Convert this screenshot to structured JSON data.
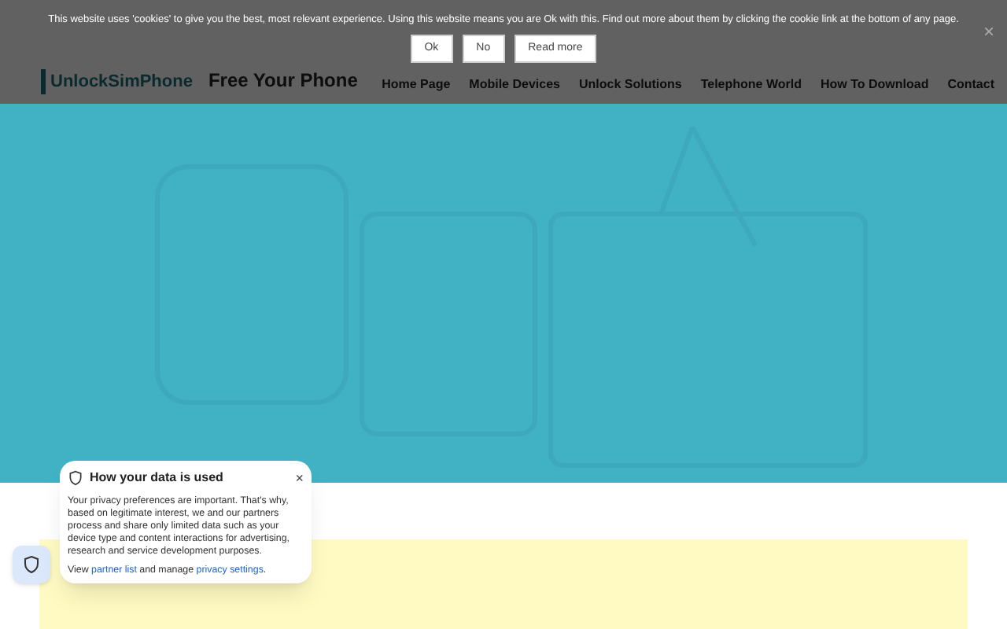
{
  "cookie_bar": {
    "message": "This website uses 'cookies' to give you the best, most relevant experience. Using this website means you are Ok with this. Find out more about them by clicking the cookie link at the bottom of any page.",
    "buttons": [
      "Ok",
      "No",
      "Read more"
    ],
    "close": "×"
  },
  "header": {
    "logo": "UnlockSimPhone",
    "tagline": "Free Your Phone",
    "nav": [
      "Home Page",
      "Mobile Devices",
      "Unlock Solutions",
      "Telephone World",
      "How To Download",
      "Contact"
    ]
  },
  "privacy_popup": {
    "title": "How your data is used",
    "close": "×",
    "body": "Your privacy preferences are important. That's why, based on legitimate interest, we and our partners process and share only limited data such as your device type and content interactions for advertising, research and service development purposes.",
    "footer_start": "View ",
    "partner_link": "partner list",
    "footer_middle": " and manage ",
    "settings_link": "privacy settings",
    "footer_end": "."
  }
}
